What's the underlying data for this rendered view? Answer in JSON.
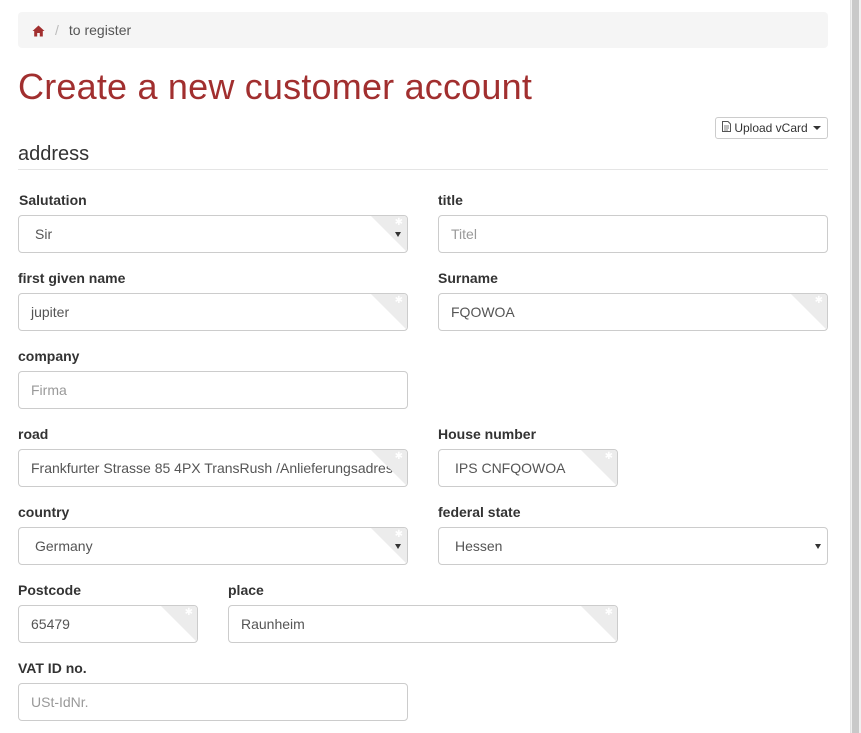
{
  "breadcrumb": {
    "current": "to register"
  },
  "page": {
    "title": "Create a new customer account"
  },
  "vcard": {
    "label": "Upload vCard"
  },
  "section": {
    "legend": "address"
  },
  "fields": {
    "salutation": {
      "label": "Salutation",
      "value": "Sir"
    },
    "title": {
      "label": "title",
      "placeholder": "Titel"
    },
    "first_name": {
      "label": "first given name",
      "value": "jupiter"
    },
    "surname": {
      "label": "Surname",
      "value": "FQOWOA"
    },
    "company": {
      "label": "company",
      "placeholder": "Firma"
    },
    "road": {
      "label": "road",
      "value": "Frankfurter Strasse 85 4PX TransRush /Anlieferungsadres"
    },
    "house_number": {
      "label": "House number",
      "value": "IPS CNFQOWOA"
    },
    "country": {
      "label": "country",
      "value": "Germany"
    },
    "federal_state": {
      "label": "federal state",
      "value": "Hessen"
    },
    "postcode": {
      "label": "Postcode",
      "value": "65479"
    },
    "place": {
      "label": "place",
      "value": "Raunheim"
    },
    "vat_id": {
      "label": "VAT ID no.",
      "placeholder": "USt-IdNr."
    }
  },
  "colors": {
    "accent": "#a12f2f"
  }
}
